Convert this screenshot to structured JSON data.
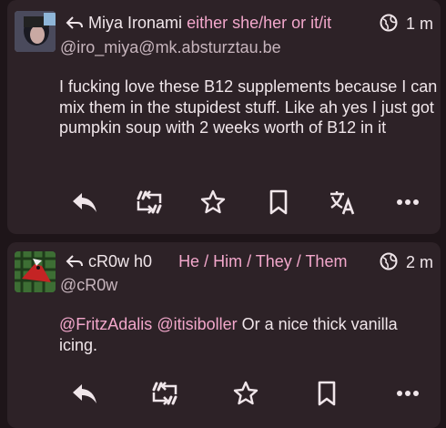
{
  "colors": {
    "accent": "#f2a7cb",
    "card": "#2d2227",
    "background": "#1e1519",
    "text": "#f0e6ea"
  },
  "posts": [
    {
      "name": "Miya Ironami",
      "pronouns": "either she/her or it/it",
      "handle": "@iro_miya@mk.absturztau.be",
      "time": "1 m",
      "body": "I fucking love these B12 supplements because I can mix them in the stupidest stuff. Like ah yes I just got pumpkin soup with 2 weeks worth of B12 in it",
      "actions": [
        "reply-icon",
        "boost-icon",
        "favourite-icon",
        "bookmark-icon",
        "translate-icon",
        "more-icon"
      ]
    },
    {
      "name": "cR0w h0",
      "pronouns": "He / Him / They / Them",
      "handle": "@cR0w",
      "time": "2 m",
      "mention1": "@FritzAdalis",
      "mention2": "@itisiboller",
      "body_rest": " Or a nice thick vanilla icing.",
      "actions": [
        "reply-icon",
        "boost-icon",
        "favourite-icon",
        "bookmark-icon",
        "more-icon"
      ]
    }
  ]
}
